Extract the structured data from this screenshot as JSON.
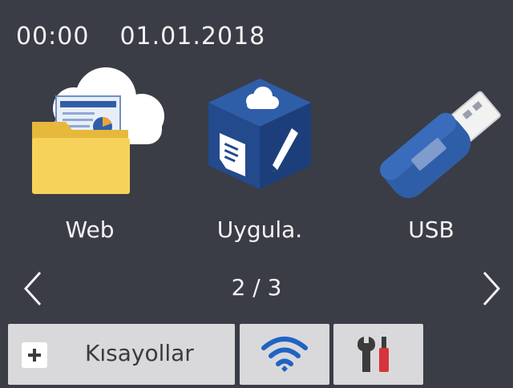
{
  "status_bar": {
    "time": "00:00",
    "date": "01.01.2018"
  },
  "apps": [
    {
      "label": "Web",
      "icon": "web-cloud-folder-icon"
    },
    {
      "label": "Uygula.",
      "icon": "apps-cube-icon"
    },
    {
      "label": "USB",
      "icon": "usb-drive-icon"
    }
  ],
  "pager": {
    "indicator": "2 / 3",
    "prev_icon": "chevron-left-icon",
    "next_icon": "chevron-right-icon"
  },
  "bottom_bar": {
    "shortcuts_label": "Kısayollar",
    "shortcuts_icon": "plus-icon",
    "wifi_icon": "wifi-icon",
    "settings_icon": "settings-tools-icon"
  },
  "colors": {
    "background": "#3a3d46",
    "text": "#f2f2f2",
    "button_bg": "#d9d9db",
    "accent_blue": "#2f5ea8",
    "folder_yellow": "#f6d25a",
    "tool_red": "#d6333b"
  }
}
